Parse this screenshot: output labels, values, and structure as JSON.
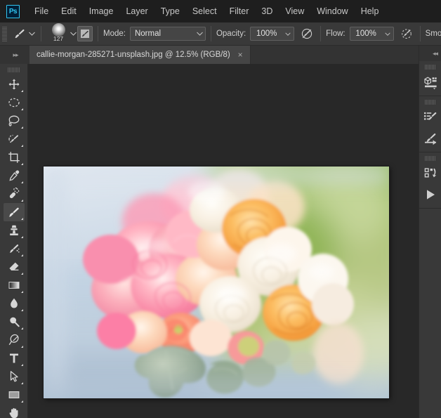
{
  "app": {
    "logo_text": "Ps",
    "accent_color": "#31c5f0"
  },
  "menubar": {
    "items": [
      {
        "label": "File"
      },
      {
        "label": "Edit"
      },
      {
        "label": "Image"
      },
      {
        "label": "Layer"
      },
      {
        "label": "Type"
      },
      {
        "label": "Select"
      },
      {
        "label": "Filter"
      },
      {
        "label": "3D"
      },
      {
        "label": "View"
      },
      {
        "label": "Window"
      },
      {
        "label": "Help"
      }
    ]
  },
  "options_bar": {
    "tool_icon": "brush-icon",
    "brush_size": "127",
    "brush_panel_icon": "brush-settings-icon",
    "mode_label": "Mode:",
    "mode_value": "Normal",
    "opacity_label": "Opacity:",
    "opacity_value": "100%",
    "opacity_pressure_icon": "pressure-opacity-icon",
    "flow_label": "Flow:",
    "flow_value": "100%",
    "airbrush_icon": "airbrush-icon",
    "smoothing_label": "Smoo"
  },
  "tabbar": {
    "collapse_icon": "expand-arrows-icon",
    "document_title": "callie-morgan-285271-unsplash.jpg @ 12.5% (RGB/8)",
    "close_label": "×"
  },
  "toolbar": {
    "tools": [
      {
        "name": "move-tool",
        "selected": false
      },
      {
        "name": "elliptical-marquee-tool",
        "selected": false
      },
      {
        "name": "lasso-tool",
        "selected": false
      },
      {
        "name": "quick-selection-tool",
        "selected": false
      },
      {
        "name": "crop-tool",
        "selected": false
      },
      {
        "name": "eyedropper-tool",
        "selected": false
      },
      {
        "name": "healing-brush-tool",
        "selected": false
      },
      {
        "name": "brush-tool",
        "selected": true
      },
      {
        "name": "clone-stamp-tool",
        "selected": false
      },
      {
        "name": "history-brush-tool",
        "selected": false
      },
      {
        "name": "eraser-tool",
        "selected": false
      },
      {
        "name": "gradient-tool",
        "selected": false
      },
      {
        "name": "blur-tool",
        "selected": false
      },
      {
        "name": "dodge-tool",
        "selected": false
      },
      {
        "name": "pen-tool",
        "selected": false
      },
      {
        "name": "type-tool",
        "selected": false
      },
      {
        "name": "path-selection-tool",
        "selected": false
      },
      {
        "name": "rectangle-tool",
        "selected": false
      },
      {
        "name": "hand-tool",
        "selected": false
      }
    ]
  },
  "dock": {
    "collapse_icon": "collapse-arrows-icon",
    "panels": [
      {
        "name": "libraries-panel-icon"
      },
      {
        "name": "brush-presets-panel-icon"
      },
      {
        "name": "brush-settings-panel-icon"
      },
      {
        "name": "history-panel-icon"
      },
      {
        "name": "actions-play-panel-icon"
      }
    ]
  },
  "canvas": {
    "zoom": "12.5%",
    "color_mode": "RGB/8",
    "image_description": "Close-up photograph of a floral bouquet with pink, peach, cream and orange roses and ranunculus with sage-green dusty miller leaves, against a soft blue-gray and green blurred background",
    "background_color": "#282828"
  }
}
